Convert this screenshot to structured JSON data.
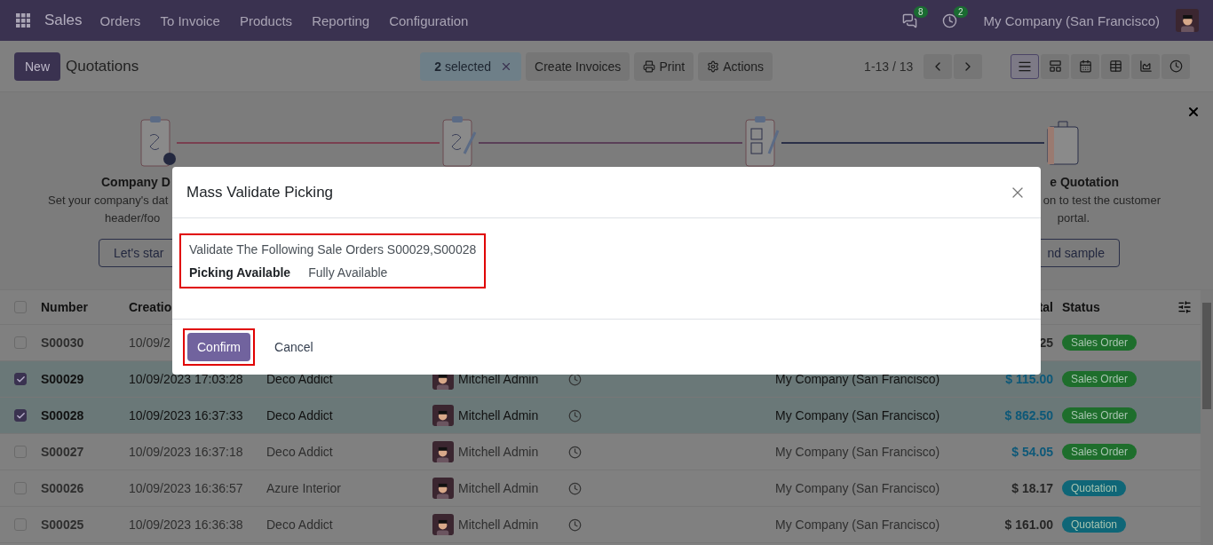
{
  "navbar": {
    "app": "Sales",
    "menu": [
      "Orders",
      "To Invoice",
      "Products",
      "Reporting",
      "Configuration"
    ],
    "messages_count": "8",
    "activities_count": "2",
    "company": "My Company (San Francisco)"
  },
  "control_panel": {
    "new_button": "New",
    "title": "Quotations",
    "selection": {
      "count": "2",
      "label": "selected"
    },
    "actions": [
      {
        "kind": "plain",
        "label": "Create Invoices"
      },
      {
        "kind": "print",
        "label": "Print"
      },
      {
        "kind": "gear",
        "label": "Actions"
      }
    ],
    "pager": "1-13 / 13",
    "views": [
      {
        "kind": "list",
        "selected": true
      },
      {
        "kind": "kanban",
        "selected": false
      },
      {
        "kind": "calendar",
        "selected": false
      },
      {
        "kind": "pivot",
        "selected": false
      },
      {
        "kind": "graph",
        "selected": false
      },
      {
        "kind": "activity",
        "selected": false
      }
    ]
  },
  "onboarding": {
    "first_step": {
      "title": "Company D",
      "lines": [
        "Set your company's dat",
        "header/foo"
      ],
      "button": "Let's star"
    },
    "last_step": {
      "title": "e Quotation",
      "lines": [
        "on to test the customer",
        "portal."
      ],
      "button": "nd sample"
    }
  },
  "table": {
    "all_checked": false,
    "columns": [
      "Number",
      "Creatio",
      "tal",
      "Status"
    ],
    "rows": [
      {
        "checked": false,
        "number": "S00030",
        "date": "10/09/2",
        "total": "25",
        "total_highlighted": false,
        "status": {
          "label": "Sales Order",
          "color": "#1e6e2c"
        }
      },
      {
        "checked": true,
        "number": "S00029",
        "date": "10/09/2023 17:03:28",
        "customer": "Deco Addict",
        "salesperson": "Mitchell Admin",
        "company": "My Company (San Francisco)",
        "total": "$ 115.00",
        "total_highlighted": true,
        "status": {
          "label": "Sales Order",
          "color": "#1e6e2c"
        }
      },
      {
        "checked": true,
        "number": "S00028",
        "date": "10/09/2023 16:37:33",
        "customer": "Deco Addict",
        "salesperson": "Mitchell Admin",
        "company": "My Company (San Francisco)",
        "total": "$ 862.50",
        "total_highlighted": true,
        "status": {
          "label": "Sales Order",
          "color": "#1e6e2c"
        }
      },
      {
        "checked": false,
        "number": "S00027",
        "date": "10/09/2023 16:37:18",
        "customer": "Deco Addict",
        "salesperson": "Mitchell Admin",
        "company": "My Company (San Francisco)",
        "total": "$ 54.05",
        "total_highlighted": true,
        "status": {
          "label": "Sales Order",
          "color": "#1e6e2c"
        }
      },
      {
        "checked": false,
        "number": "S00026",
        "date": "10/09/2023 16:36:57",
        "customer": "Azure Interior",
        "salesperson": "Mitchell Admin",
        "company": "My Company (San Francisco)",
        "total": "$ 18.17",
        "total_highlighted": false,
        "status": {
          "label": "Quotation",
          "color": "#0f6677"
        }
      },
      {
        "checked": false,
        "number": "S00025",
        "date": "10/09/2023 16:36:38",
        "customer": "Deco Addict",
        "salesperson": "Mitchell Admin",
        "company": "My Company (San Francisco)",
        "total": "$ 161.00",
        "total_highlighted": false,
        "status": {
          "label": "Quotation",
          "color": "#0f6677"
        }
      }
    ]
  },
  "dialog": {
    "title": "Mass Validate Picking",
    "message": "Validate The Following Sale Orders S00029,S00028",
    "field_label": "Picking Available",
    "field_value": "Fully Available",
    "body_highlighted": true,
    "buttons": [
      {
        "kind": "primary",
        "label": "Confirm",
        "highlighted": true
      },
      {
        "kind": "secondary",
        "label": "Cancel",
        "highlighted": false
      }
    ]
  }
}
